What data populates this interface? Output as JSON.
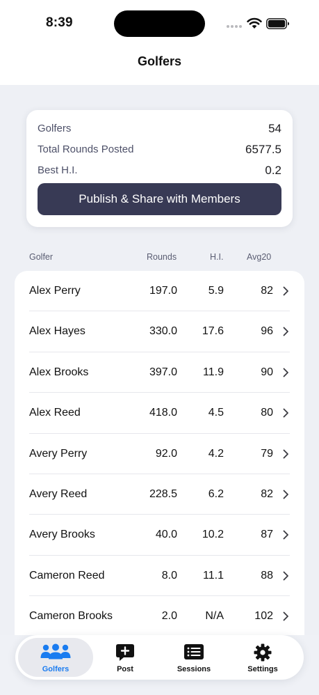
{
  "status_bar": {
    "time": "8:39"
  },
  "header": {
    "title": "Golfers"
  },
  "summary": {
    "rows": [
      {
        "label": "Golfers",
        "value": "54"
      },
      {
        "label": "Total Rounds Posted",
        "value": "6577.5"
      },
      {
        "label": "Best H.I.",
        "value": "0.2"
      }
    ],
    "publish_label": "Publish & Share with Members"
  },
  "columns": {
    "golfer": "Golfer",
    "rounds": "Rounds",
    "hi": "H.I.",
    "avg20": "Avg20"
  },
  "golfers": [
    {
      "name": "Alex Perry",
      "rounds": "197.0",
      "hi": "5.9",
      "avg20": "82"
    },
    {
      "name": "Alex Hayes",
      "rounds": "330.0",
      "hi": "17.6",
      "avg20": "96"
    },
    {
      "name": "Alex Brooks",
      "rounds": "397.0",
      "hi": "11.9",
      "avg20": "90"
    },
    {
      "name": "Alex Reed",
      "rounds": "418.0",
      "hi": "4.5",
      "avg20": "80"
    },
    {
      "name": "Avery Perry",
      "rounds": "92.0",
      "hi": "4.2",
      "avg20": "79"
    },
    {
      "name": "Avery Reed",
      "rounds": "228.5",
      "hi": "6.2",
      "avg20": "82"
    },
    {
      "name": "Avery Brooks",
      "rounds": "40.0",
      "hi": "10.2",
      "avg20": "87"
    },
    {
      "name": "Cameron Reed",
      "rounds": "8.0",
      "hi": "11.1",
      "avg20": "88"
    },
    {
      "name": "Cameron Brooks",
      "rounds": "2.0",
      "hi": "N/A",
      "avg20": "102"
    }
  ],
  "tabs": [
    {
      "label": "Golfers",
      "icon": "people-icon",
      "active": true
    },
    {
      "label": "Post",
      "icon": "post-icon",
      "active": false
    },
    {
      "label": "Sessions",
      "icon": "list-icon",
      "active": false
    },
    {
      "label": "Settings",
      "icon": "gear-icon",
      "active": false
    }
  ],
  "colors": {
    "accent": "#1a7cf0",
    "button": "#383a55",
    "background": "#eef0f5"
  }
}
